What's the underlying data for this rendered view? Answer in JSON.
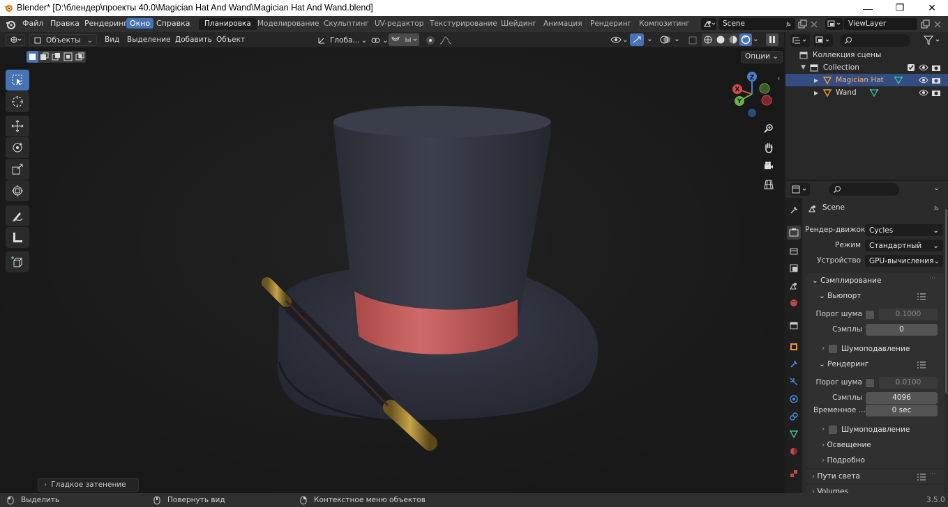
{
  "window": {
    "title": "Blender* [D:\\блендер\\проекты 40.0\\Magician Hat And Wand\\Magician Hat And Wand.blend]"
  },
  "menus": [
    "Файл",
    "Правка",
    "Рендеринг",
    "Окно",
    "Справка"
  ],
  "workspaces": [
    "Планировка",
    "Моделирование",
    "Скульптинг",
    "UV-редактор",
    "Текстурирование",
    "Шейдинг",
    "Анимация",
    "Рендеринг",
    "Композитинг"
  ],
  "scene": {
    "name": "Scene",
    "view_layer": "ViewLayer"
  },
  "viewport": {
    "mode": "Объекты",
    "menu": [
      "Вид",
      "Выделение",
      "Добавить",
      "Объект"
    ],
    "orientation": "Глоба...",
    "options": "Опции",
    "last_op": "Гладкое затенение",
    "gizmo": {
      "x": "X",
      "y": "Y",
      "z": "Z"
    }
  },
  "outliner": {
    "root": "Коллекция сцены",
    "collection": "Collection",
    "items": [
      "Magician Hat",
      "Wand"
    ]
  },
  "properties": {
    "context": "Scene",
    "render_engine_label": "Рендер-движок",
    "render_engine": "Cycles",
    "mode_label": "Режим",
    "mode": "Стандартный",
    "device_label": "Устройство",
    "device": "GPU-вычисления",
    "sampling": "Сэмплирование",
    "viewport": "Вьюпорт",
    "noise_label": "Порог шума",
    "viewport_noise": "0.1000",
    "samples_label": "Сэмплы",
    "viewport_samples": "0",
    "denoise": "Шумоподавление",
    "render": "Рендеринг",
    "render_noise": "0.0100",
    "render_samples": "4096",
    "time_label": "Временное ...",
    "time_value": "0 sec",
    "denoise2": "Шумоподавление",
    "lighting": "Освещение",
    "advanced": "Подробно",
    "light_paths": "Пути света",
    "volumes": "Volumes"
  },
  "status": {
    "select": "Выделить",
    "rotate": "Повернуть вид",
    "context_menu": "Контекстное меню объектов",
    "version": "3.5.0"
  },
  "colors": {
    "accent": "#4772b3",
    "hat_band": "#c05a5a",
    "wand_tip": "#b89a3a"
  }
}
